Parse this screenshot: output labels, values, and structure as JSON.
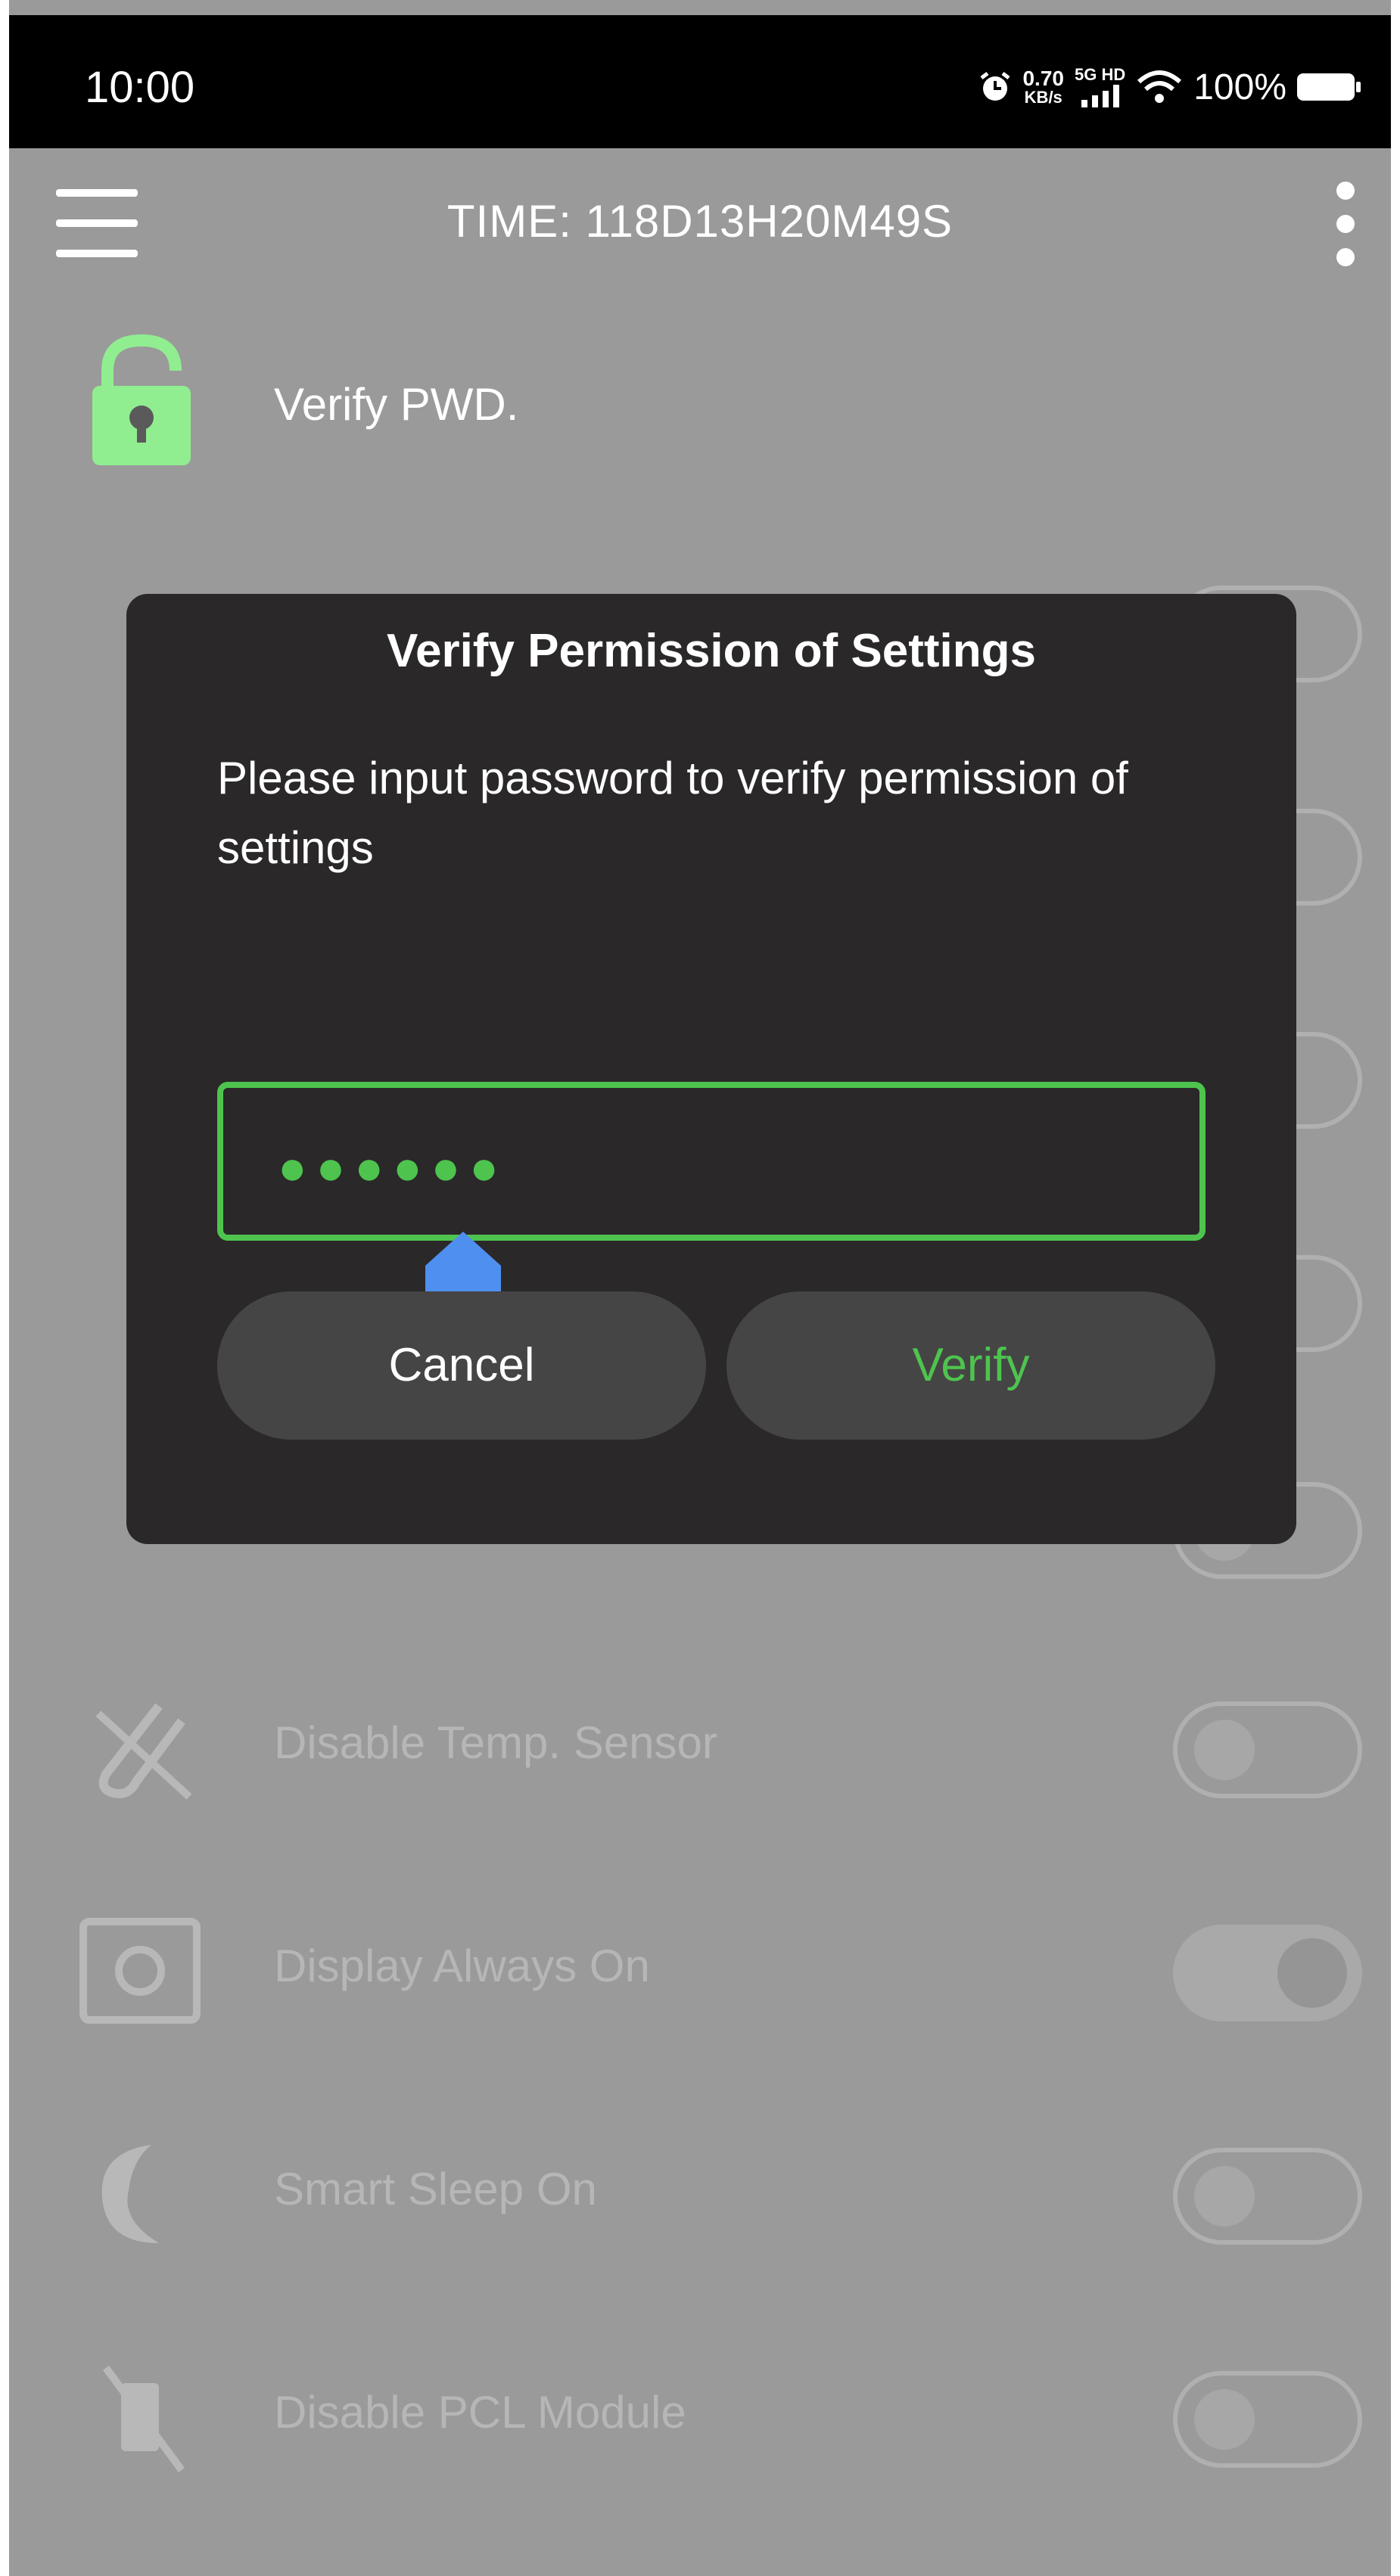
{
  "status_bar": {
    "time": "10:00",
    "net_speed_value": "0.70",
    "net_speed_unit": "KB/s",
    "network": "5G HD",
    "battery": "100%",
    "icons": [
      "alarm-icon",
      "signal-icon",
      "wifi-icon",
      "battery-icon"
    ]
  },
  "app_bar": {
    "title": "TIME: 118D13H20M49S",
    "menu_icon": "hamburger-icon",
    "more_icon": "more-vert-icon"
  },
  "verify_item": {
    "label": "Verify PWD.",
    "icon": "lock-icon",
    "icon_color": "#90ee90"
  },
  "settings": [
    {
      "label": "Disable Temp. Sensor",
      "icon": "temp-sensor-off-icon",
      "enabled": false
    },
    {
      "label": "Display Always On",
      "icon": "display-icon",
      "enabled": true
    },
    {
      "label": "Smart Sleep On",
      "icon": "moon-icon",
      "enabled": false
    },
    {
      "label": "Disable PCL Module",
      "icon": "pcl-module-off-icon",
      "enabled": false
    }
  ],
  "dialog": {
    "title": "Verify Permission of Settings",
    "message": "Please input password to verify permission of settings",
    "password_mask": "●●●●●●",
    "cancel_label": "Cancel",
    "verify_label": "Verify",
    "accent_color": "#4ec44e"
  }
}
